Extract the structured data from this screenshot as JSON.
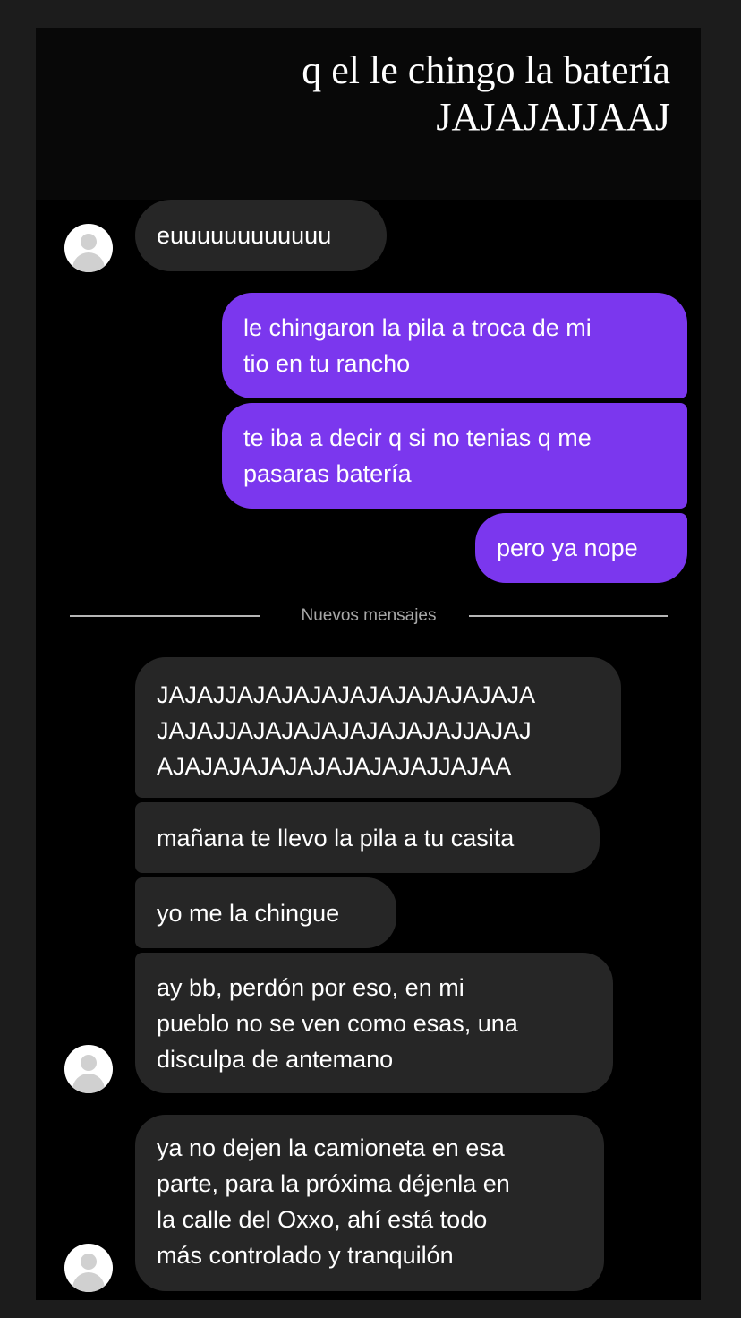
{
  "story_caption": {
    "line1": "q el le chingo la batería",
    "line2": "JAJAJAJJAAJ"
  },
  "divider": {
    "label": "Nuevos mensajes"
  },
  "messages": {
    "m1": "euuuuuuuuuuuu",
    "m2_l1": "le chingaron la pila a troca de mi",
    "m2_l2": "tio en tu rancho",
    "m3_l1": "te iba a decir q si no tenias q me",
    "m3_l2": "pasaras batería",
    "m4": "pero ya nope",
    "m5_l1": "JAJAJJAJAJAJAJAJAJAJAJAJAJA",
    "m5_l2": "JAJAJJAJAJAJAJAJAJAJAJJAJAJ",
    "m5_l3": "AJAJAJAJAJAJAJAJAJAJJAJAA",
    "m6": "mañana te llevo la pila a tu casita",
    "m7": "yo me la chingue",
    "m8_l1": "ay bb, perdón por eso, en mi",
    "m8_l2": "pueblo no se ven como esas, una",
    "m8_l3": "disculpa de antemano",
    "m9_l1": "ya no dejen la camioneta en esa",
    "m9_l2": "parte, para la próxima déjenla en",
    "m9_l3": "la calle del Oxxo, ahí está todo",
    "m9_l4": "más controlado y tranquilón"
  },
  "colors": {
    "sent_bubble": "#7b37ee",
    "received_bubble": "#262626",
    "background": "#000000",
    "outer_background": "#1c1c1c"
  },
  "icons": {
    "avatar": "default-user-avatar-icon"
  }
}
